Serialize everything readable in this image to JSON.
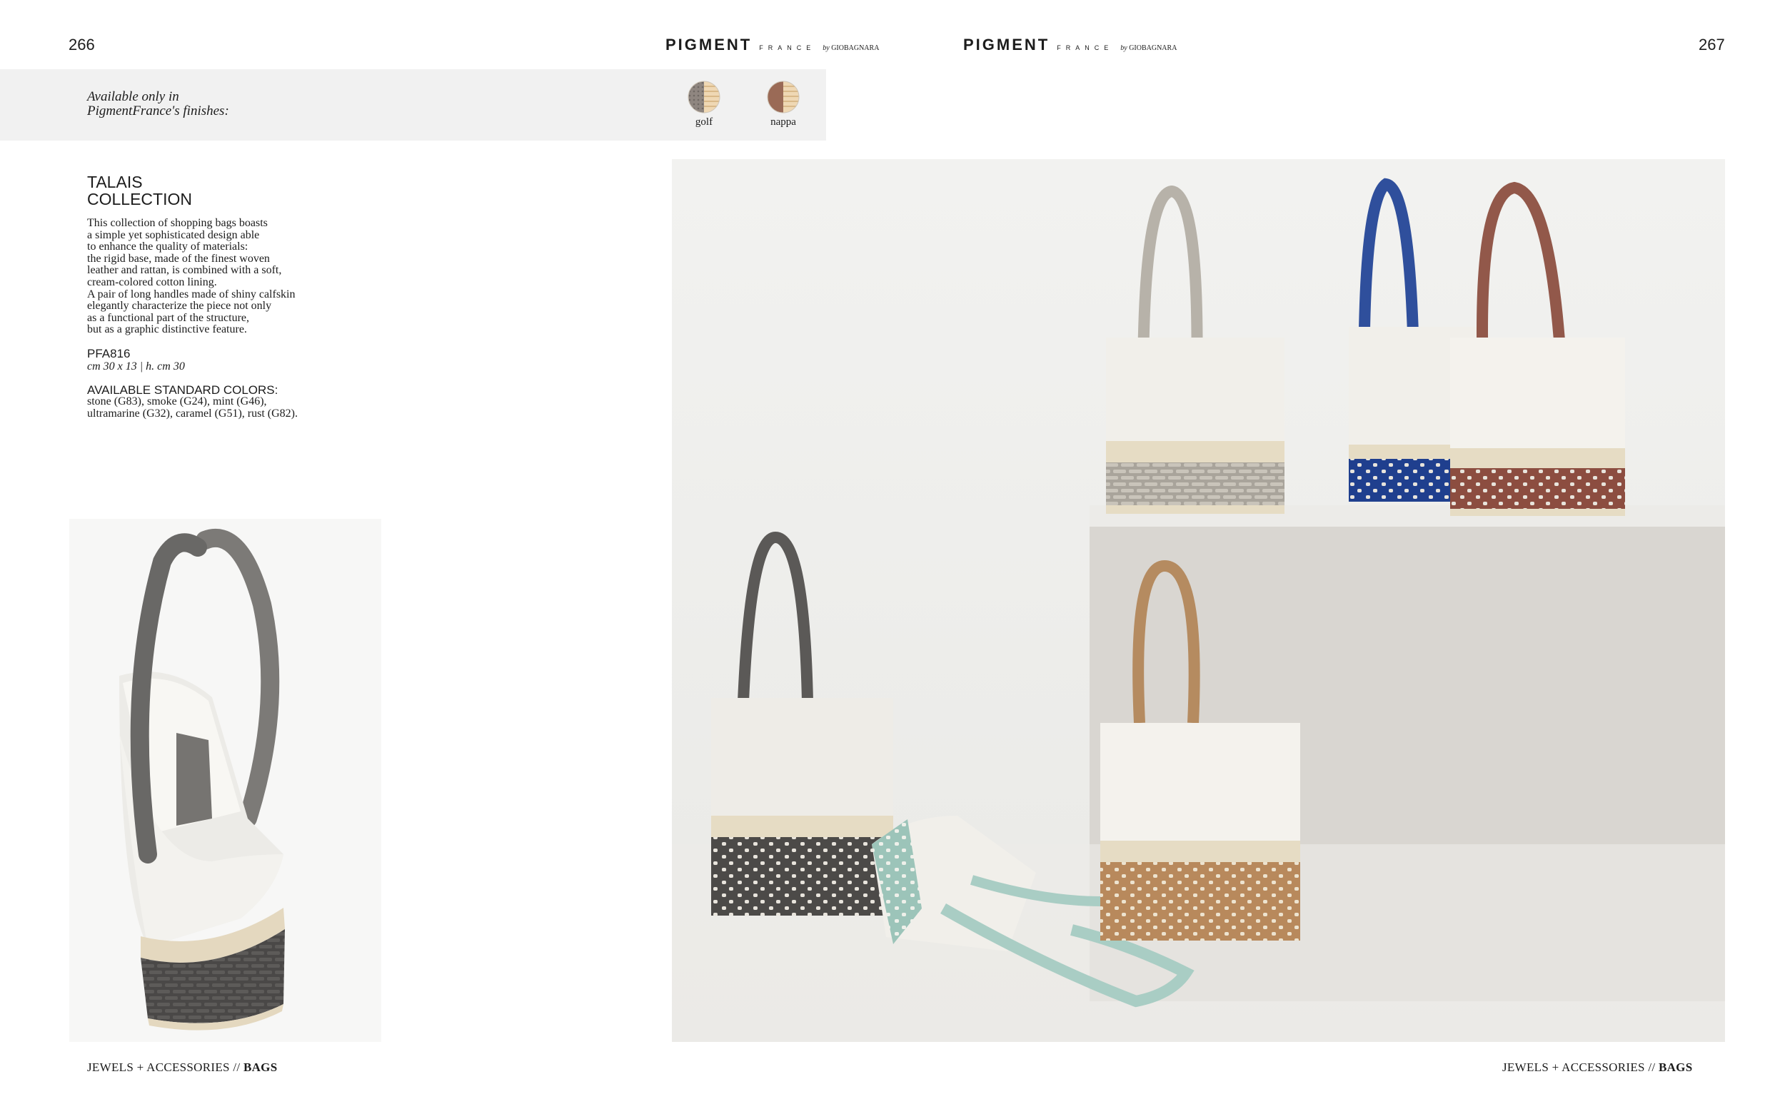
{
  "spread": {
    "left_page_number": "266",
    "right_page_number": "267"
  },
  "header": {
    "brand_name": "PIGMENT",
    "brand_sub": "FRANCE",
    "brand_by": "by",
    "brand_maker": "GIOBAGNARA"
  },
  "finishes": {
    "label_line1": "Available only in",
    "label_line2": "PigmentFrance's finishes:",
    "items": [
      {
        "name": "golf",
        "color": "#8f8680"
      },
      {
        "name": "nappa",
        "color": "#9a6a56"
      }
    ]
  },
  "collection": {
    "title_line1": "TALAIS",
    "title_line2": "COLLECTION",
    "description": [
      "This collection of shopping bags boasts",
      "a simple yet sophisticated design able",
      "to enhance the quality of materials:",
      "the rigid base, made of the finest woven",
      "leather and rattan, is combined with a soft,",
      "cream-colored cotton lining.",
      "A pair of long handles made of shiny calfskin",
      "elegantly characterize the piece not only",
      "as a functional part of the structure,",
      "but as a graphic distinctive feature."
    ],
    "code": "PFA816",
    "dimensions": "cm 30 x 13  |  h. cm 30",
    "colors_title": "AVAILABLE STANDARD COLORS:",
    "colors_line1": "stone (G83), smoke (G24), mint (G46),",
    "colors_line2": "ultramarine (G32), caramel (G51),  rust (G82)."
  },
  "footer": {
    "section": "JEWELS + ACCESSORIES //",
    "category": "BAGS"
  },
  "palette": {
    "stone_handle": "#b7b2a9",
    "smoke": "#5b5957",
    "mint": "#a9cdc4",
    "ultramarine": "#2f4f9c",
    "caramel": "#b58b60",
    "rust": "#92584a",
    "canvas": "#f1efea",
    "rattan": "#e6dcc4"
  }
}
